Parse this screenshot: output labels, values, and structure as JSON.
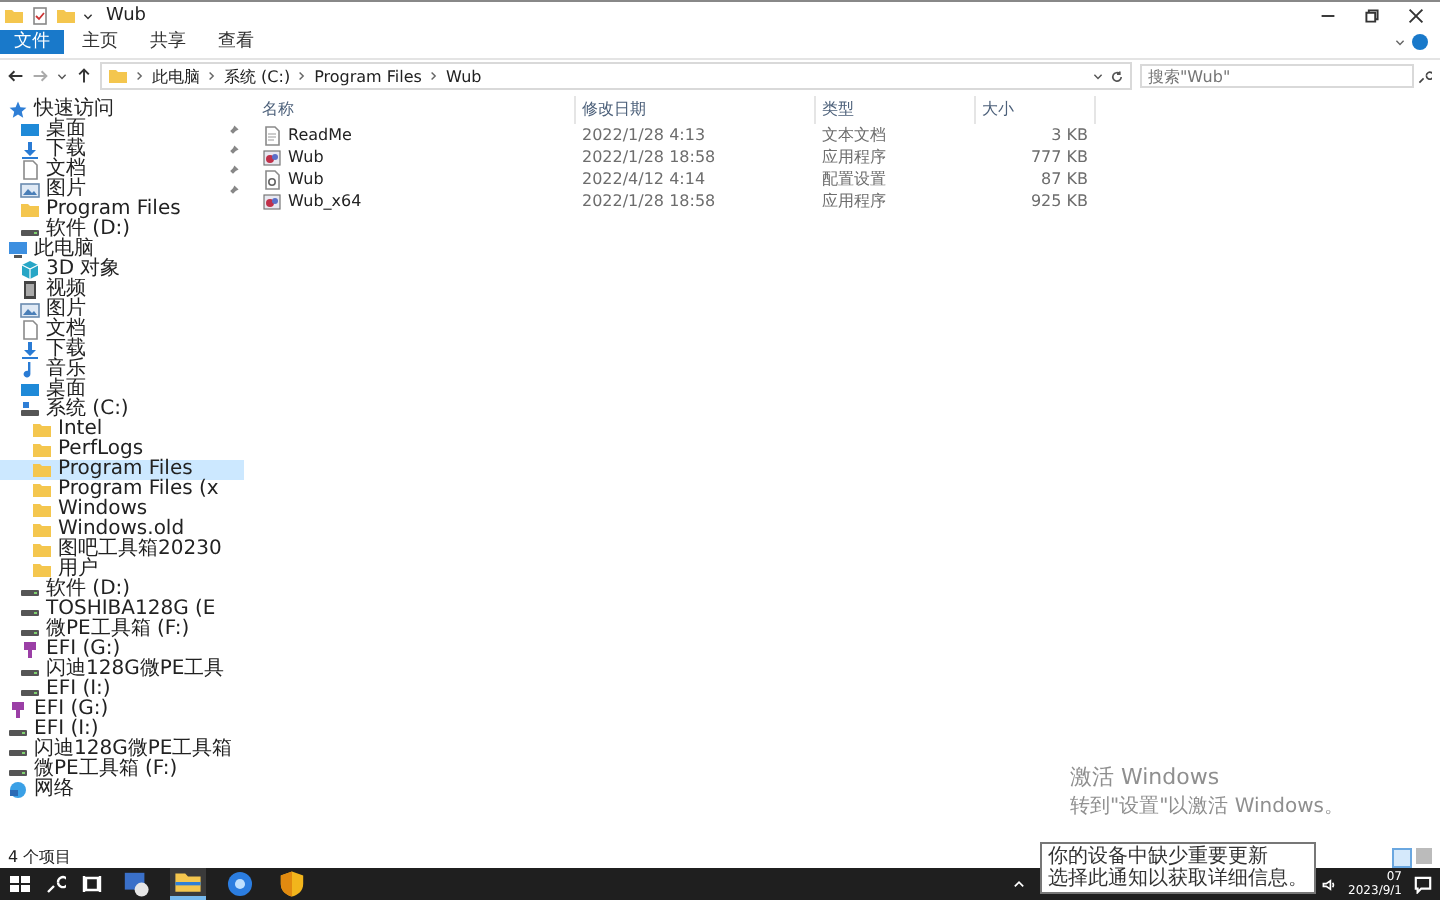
{
  "window": {
    "title": "Wub"
  },
  "ribbon_tabs": [
    {
      "label": "文件",
      "kind": "file",
      "selected": false
    },
    {
      "label": "主页",
      "kind": "tab",
      "selected": false
    },
    {
      "label": "共享",
      "kind": "tab",
      "selected": false
    },
    {
      "label": "查看",
      "kind": "tab",
      "selected": false
    }
  ],
  "address": {
    "path": [
      "此电脑",
      "系统 (C:)",
      "Program Files",
      "Wub"
    ]
  },
  "search": {
    "placeholder": "搜索\"Wub\""
  },
  "sidebar": {
    "items": [
      {
        "label": "快速访问",
        "kind": "star",
        "selected": false,
        "children": [
          {
            "label": "桌面",
            "kind": "desktop",
            "selected": false,
            "pinned": true
          },
          {
            "label": "下载",
            "kind": "download",
            "selected": false,
            "pinned": true
          },
          {
            "label": "文档",
            "kind": "document",
            "selected": false,
            "pinned": true
          },
          {
            "label": "图片",
            "kind": "picture",
            "selected": false,
            "pinned": true
          },
          {
            "label": "Program Files",
            "kind": "folder",
            "selected": false,
            "pinned": false
          },
          {
            "label": "软件 (D:)",
            "kind": "drive",
            "selected": false,
            "pinned": false
          }
        ]
      },
      {
        "label": "此电脑",
        "kind": "computer",
        "selected": false,
        "children": [
          {
            "label": "3D 对象",
            "kind": "cube",
            "selected": false
          },
          {
            "label": "视频",
            "kind": "video",
            "selected": false
          },
          {
            "label": "图片",
            "kind": "picture",
            "selected": false
          },
          {
            "label": "文档",
            "kind": "document",
            "selected": false
          },
          {
            "label": "下载",
            "kind": "download",
            "selected": false
          },
          {
            "label": "音乐",
            "kind": "music",
            "selected": false
          },
          {
            "label": "桌面",
            "kind": "desktop",
            "selected": false
          },
          {
            "label": "系统 (C:)",
            "kind": "system-drive",
            "selected": false,
            "children": [
              {
                "label": "Intel",
                "kind": "folder",
                "selected": false
              },
              {
                "label": "PerfLogs",
                "kind": "folder",
                "selected": false
              },
              {
                "label": "Program Files",
                "kind": "folder",
                "selected": true
              },
              {
                "label": "Program Files (x",
                "kind": "folder",
                "selected": false
              },
              {
                "label": "Windows",
                "kind": "folder",
                "selected": false
              },
              {
                "label": "Windows.old",
                "kind": "folder",
                "selected": false
              },
              {
                "label": "图吧工具箱20230",
                "kind": "folder",
                "selected": false
              },
              {
                "label": "用户",
                "kind": "folder",
                "selected": false
              }
            ]
          },
          {
            "label": "软件 (D:)",
            "kind": "drive",
            "selected": false
          },
          {
            "label": "TOSHIBA128G (E",
            "kind": "drive",
            "selected": false
          },
          {
            "label": "微PE工具箱 (F:)",
            "kind": "drive",
            "selected": false
          },
          {
            "label": "EFI (G:)",
            "kind": "usb",
            "selected": false
          },
          {
            "label": "闪迪128G微PE工具",
            "kind": "drive",
            "selected": false
          },
          {
            "label": "EFI (I:)",
            "kind": "drive",
            "selected": false
          }
        ]
      },
      {
        "label": "EFI (G:)",
        "kind": "usb",
        "selected": false
      },
      {
        "label": "EFI (I:)",
        "kind": "drive",
        "selected": false
      },
      {
        "label": "闪迪128G微PE工具箱",
        "kind": "drive",
        "selected": false
      },
      {
        "label": "微PE工具箱 (F:)",
        "kind": "drive",
        "selected": false
      },
      {
        "label": "网络",
        "kind": "network",
        "selected": false
      }
    ]
  },
  "files": {
    "columns": [
      "名称",
      "修改日期",
      "类型",
      "大小"
    ],
    "rows": [
      {
        "kind": "text",
        "name": "ReadMe",
        "modified": "2022/1/28 4:13",
        "type": "文本文档",
        "size": "3 KB"
      },
      {
        "kind": "app",
        "name": "Wub",
        "modified": "2022/1/28 18:58",
        "type": "应用程序",
        "size": "777 KB"
      },
      {
        "kind": "config",
        "name": "Wub",
        "modified": "2022/4/12 4:14",
        "type": "配置设置",
        "size": "87 KB"
      },
      {
        "kind": "app",
        "name": "Wub_x64",
        "modified": "2022/1/28 18:58",
        "type": "应用程序",
        "size": "925 KB"
      }
    ]
  },
  "status_bar": {
    "count": "4 个项目"
  },
  "activation": {
    "title": "激活 Windows",
    "hint": "转到\"设置\"以激活 Windows。"
  },
  "notification": {
    "lines": [
      "你的设备中缺少重要更新",
      "选择此通知以获取详细信息。"
    ]
  },
  "taskbar": {
    "apps": [
      {
        "kind": "network-app",
        "selected": false
      },
      {
        "kind": "explorer",
        "selected": true
      },
      {
        "kind": "browser",
        "selected": false
      },
      {
        "kind": "shield",
        "selected": false
      }
    ],
    "clock": {
      "time": "07",
      "date": "2023/9/1"
    }
  }
}
